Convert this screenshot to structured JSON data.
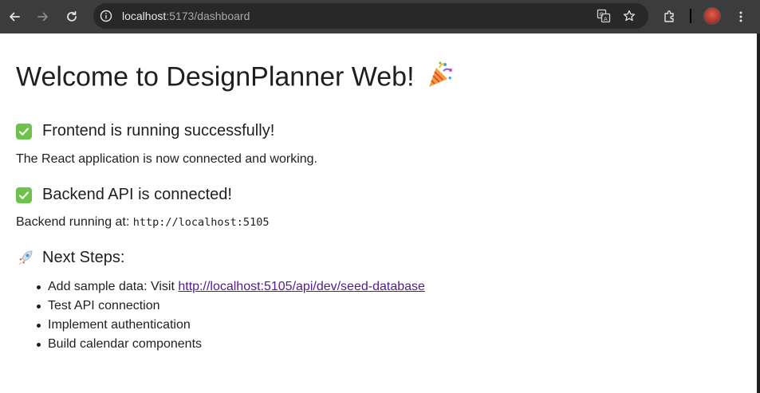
{
  "browser": {
    "url_host": "localhost",
    "url_path": ":5173/dashboard"
  },
  "page": {
    "title": "Welcome to DesignPlanner Web!",
    "frontend_heading": "Frontend is running successfully!",
    "frontend_text": "The React application is now connected and working.",
    "backend_heading": "Backend API is connected!",
    "backend_label": "Backend running at: ",
    "backend_url": "http://localhost:5105",
    "next_heading": "Next Steps:",
    "steps": [
      {
        "prefix": "Add sample data: Visit ",
        "link": "http://localhost:5105/api/dev/seed-database"
      },
      {
        "text": "Test API connection"
      },
      {
        "text": "Implement authentication"
      },
      {
        "text": "Build calendar components"
      }
    ]
  },
  "colors": {
    "toolbar": "#3c3c3c",
    "omnibox": "#282828",
    "check": "#6cc24a",
    "link_visited": "#551a8b"
  },
  "icons": [
    "back-arrow-icon",
    "forward-arrow-icon",
    "reload-icon",
    "site-info-icon",
    "translate-icon",
    "star-icon",
    "extensions-icon",
    "more-vert-icon",
    "check-mark-icon",
    "rocket-icon",
    "party-popper-icon"
  ]
}
